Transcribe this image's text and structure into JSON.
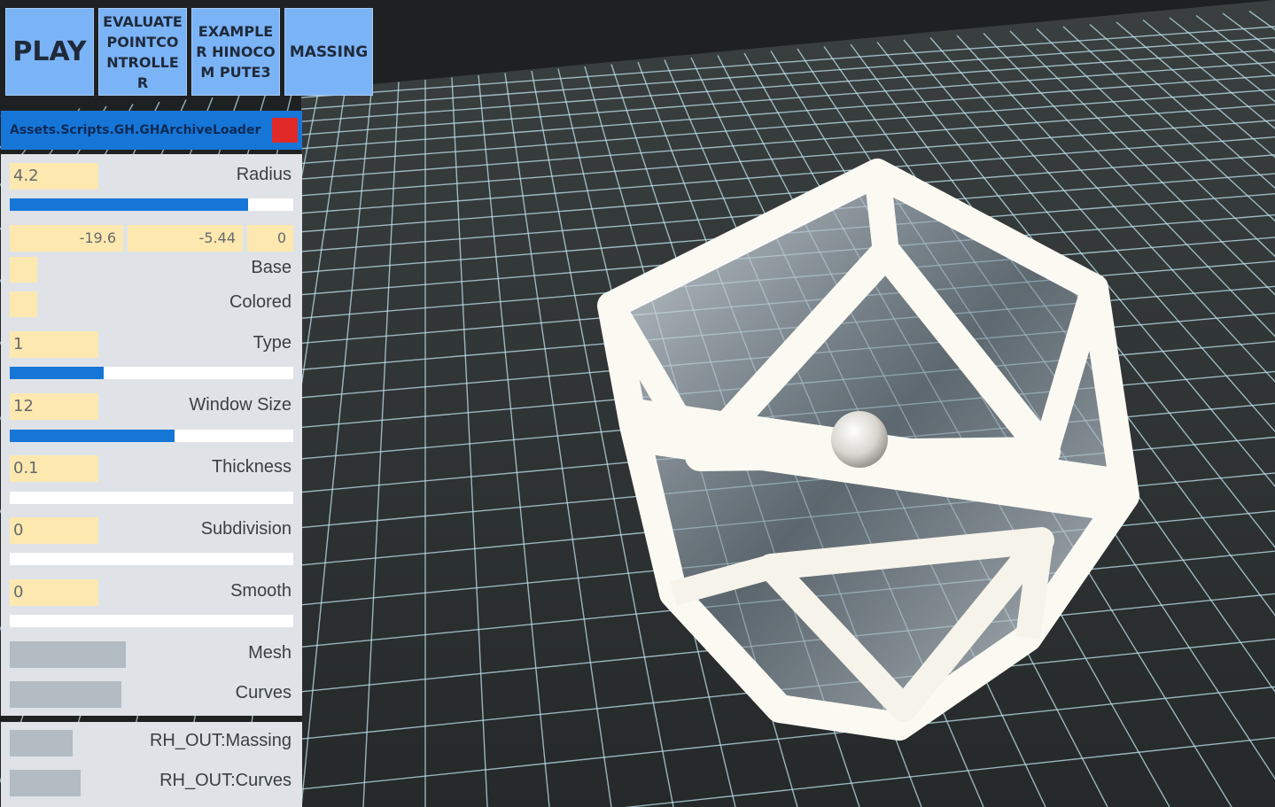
{
  "toolbar": {
    "play": "PLAY",
    "evaluate": "EVALUATE POINTCO NTROLLER",
    "exampler": "EXAMPLER HINOCOM PUTE3",
    "massing": "MASSING"
  },
  "loader": {
    "title": "Assets.Scripts.GH.GHArchiveLoader",
    "close_color": "#e02a2a"
  },
  "params": {
    "radius": {
      "value": "4.2",
      "label": "Radius",
      "slider_fraction": 0.84
    },
    "point": {
      "x": "-19.6",
      "y": "-5.44",
      "z": "0"
    },
    "base": {
      "label": "Base"
    },
    "colored": {
      "label": "Colored"
    },
    "type": {
      "value": "1",
      "label": "Type",
      "slider_fraction": 0.33
    },
    "window_size": {
      "value": "12",
      "label": "Window Size",
      "slider_fraction": 0.58
    },
    "thickness": {
      "value": "0.1",
      "label": "Thickness",
      "slider_fraction": 0
    },
    "subdivision": {
      "value": "0",
      "label": "Subdivision",
      "slider_fraction": 0
    },
    "smooth": {
      "value": "0",
      "label": "Smooth",
      "slider_fraction": 0
    },
    "mesh": {
      "label": "Mesh"
    },
    "curves": {
      "label": "Curves"
    }
  },
  "outputs": {
    "massing": {
      "label": "RH_OUT:Massing"
    },
    "curves": {
      "label": "RH_OUT:Curves"
    }
  },
  "colors": {
    "accent": "#1676d8",
    "button": "#7bb3f7",
    "field": "#fde8b0",
    "panel": "#dfe3e7",
    "grid_line": "#bfe4ec"
  }
}
